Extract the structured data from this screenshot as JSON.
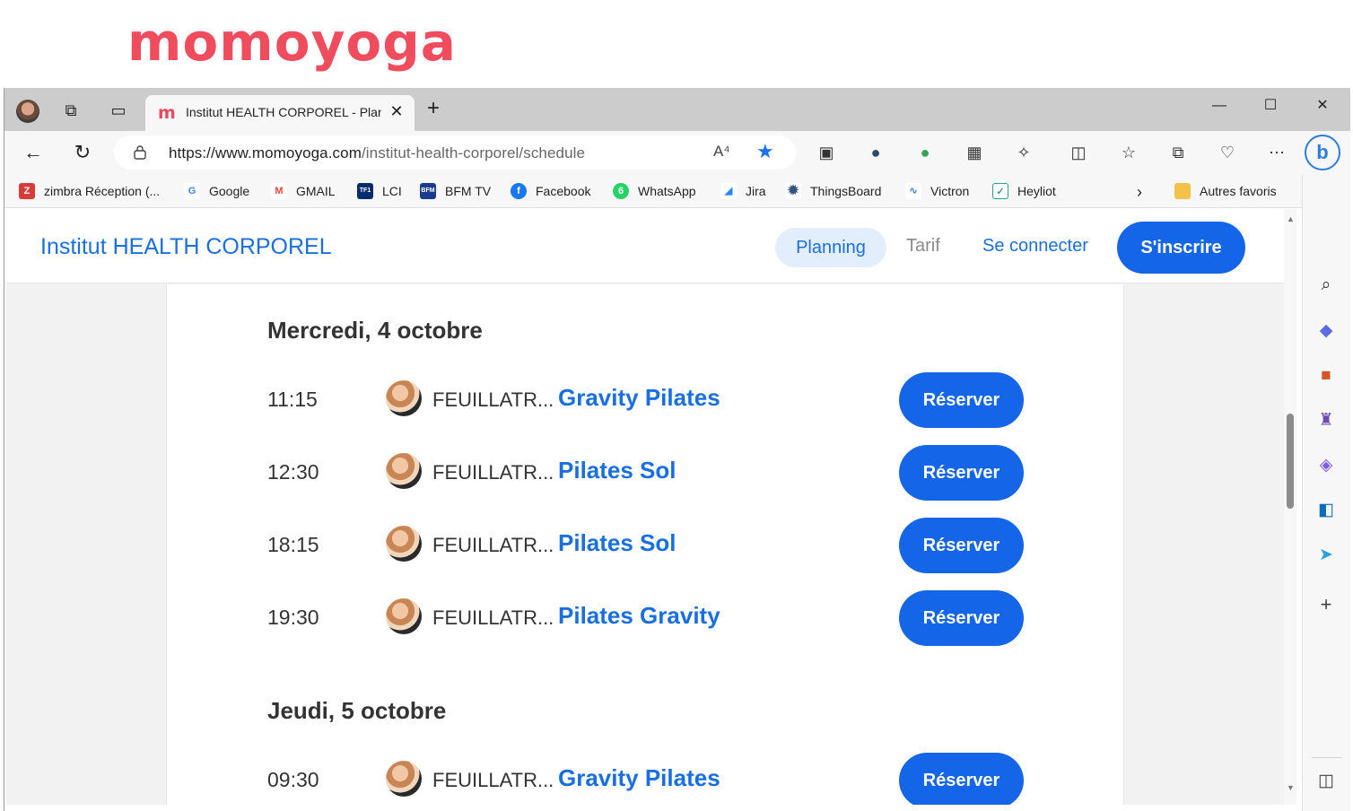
{
  "logo": {
    "text": "momoyoga"
  },
  "browser": {
    "tab": {
      "favicon": "m",
      "title": "Institut HEALTH CORPOREL - Planning"
    },
    "url": {
      "domain": "https://www.momoyoga.com",
      "path": "/institut-health-corporel/schedule"
    },
    "read_aloud_label": "A⁴",
    "bookmarks": [
      {
        "label": "zimbra Réception (...",
        "icon": "zimbra-icon",
        "color": "#d93b3b"
      },
      {
        "label": "Google",
        "icon": "google-icon",
        "color": "#4285f4"
      },
      {
        "label": "GMAIL",
        "icon": "gmail-icon",
        "color": "#ea4335"
      },
      {
        "label": "LCI",
        "icon": "lci-icon",
        "color": "#0a2b6b"
      },
      {
        "label": "BFM TV",
        "icon": "bfm-icon",
        "color": "#1a3b8c"
      },
      {
        "label": "Facebook",
        "icon": "facebook-icon",
        "color": "#1877f2"
      },
      {
        "label": "WhatsApp",
        "icon": "whatsapp-icon",
        "color": "#25d366"
      },
      {
        "label": "Jira",
        "icon": "jira-icon",
        "color": "#2684ff"
      },
      {
        "label": "ThingsBoard",
        "icon": "thingsboard-icon",
        "color": "#305680"
      },
      {
        "label": "Victron",
        "icon": "victron-icon",
        "color": "#4a7bd0"
      },
      {
        "label": "Heyliot",
        "icon": "heyliot-icon",
        "color": "#2aa198"
      }
    ],
    "other_favorites": "Autres favoris"
  },
  "site": {
    "brand": "Institut HEALTH CORPOREL",
    "nav": {
      "planning": "Planning",
      "tarif": "Tarif",
      "login": "Se connecter",
      "signup": "S'inscrire"
    },
    "days": [
      {
        "title": "Mercredi, 4 octobre",
        "classes": [
          {
            "time": "11:15",
            "teacher": "FEUILLATR...",
            "course": "Gravity Pilates",
            "action": "Réserver"
          },
          {
            "time": "12:30",
            "teacher": "FEUILLATR...",
            "course": "Pilates Sol",
            "action": "Réserver"
          },
          {
            "time": "18:15",
            "teacher": "FEUILLATR...",
            "course": "Pilates Sol",
            "action": "Réserver"
          },
          {
            "time": "19:30",
            "teacher": "FEUILLATR...",
            "course": "Pilates Gravity",
            "action": "Réserver"
          }
        ]
      },
      {
        "title": "Jeudi, 5 octobre",
        "classes": [
          {
            "time": "09:30",
            "teacher": "FEUILLATR...",
            "course": "Gravity Pilates",
            "action": "Réserver"
          }
        ]
      }
    ]
  }
}
